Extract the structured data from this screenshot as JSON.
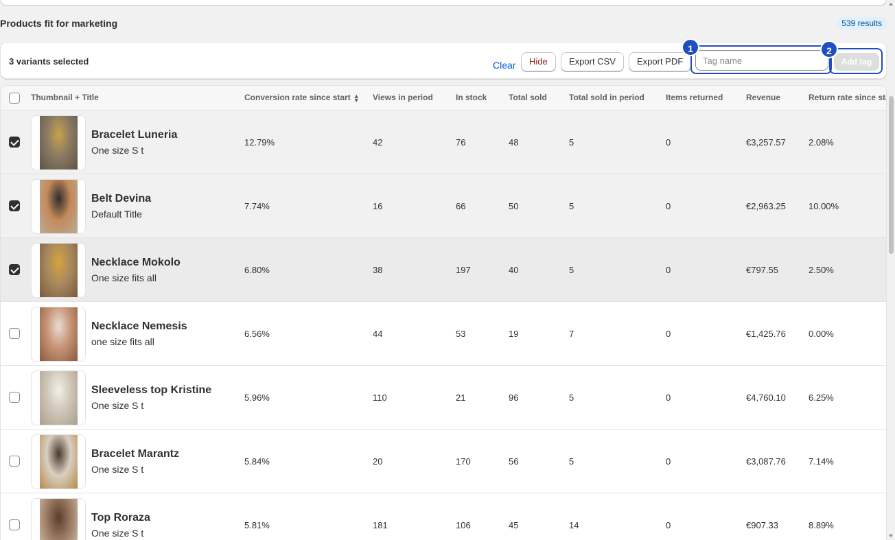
{
  "section": {
    "title": "Products fit for marketing",
    "results": "539 results"
  },
  "bulk": {
    "selected_text": "3 variants selected",
    "clear": "Clear",
    "hide": "Hide",
    "export_csv": "Export CSV",
    "export_pdf": "Export PDF",
    "tag_placeholder": "Tag name",
    "add_tag": "Add tag",
    "marker_1": "1",
    "marker_2": "2"
  },
  "columns": {
    "thumb_title": "Thumbnail + Title",
    "conversion": "Conversion rate since start",
    "views": "Views in period",
    "in_stock": "In stock",
    "total_sold": "Total sold",
    "sold_period": "Total sold in period",
    "returned": "Items returned",
    "revenue": "Revenue",
    "return_rate": "Return rate since sta"
  },
  "rows": [
    {
      "title": "Bracelet Luneria",
      "variant": "One size S t",
      "conversion": "12.79%",
      "views": "42",
      "in_stock": "76",
      "total_sold": "48",
      "sold_period": "5",
      "returned": "0",
      "revenue": "€3,257.57",
      "return_rate": "2.08%",
      "checked": true
    },
    {
      "title": "Belt Devina",
      "variant": "Default Title",
      "conversion": "7.74%",
      "views": "16",
      "in_stock": "66",
      "total_sold": "50",
      "sold_period": "5",
      "returned": "0",
      "revenue": "€2,963.25",
      "return_rate": "10.00%",
      "checked": true
    },
    {
      "title": "Necklace Mokolo",
      "variant": "One size fits all",
      "conversion": "6.80%",
      "views": "38",
      "in_stock": "197",
      "total_sold": "40",
      "sold_period": "5",
      "returned": "0",
      "revenue": "€797.55",
      "return_rate": "2.50%",
      "checked": true
    },
    {
      "title": "Necklace Nemesis",
      "variant": "one size fits all",
      "conversion": "6.56%",
      "views": "44",
      "in_stock": "53",
      "total_sold": "19",
      "sold_period": "7",
      "returned": "0",
      "revenue": "€1,425.76",
      "return_rate": "0.00%",
      "checked": false
    },
    {
      "title": "Sleeveless top Kristine",
      "variant": "One size S t",
      "conversion": "5.96%",
      "views": "110",
      "in_stock": "21",
      "total_sold": "96",
      "sold_period": "5",
      "returned": "0",
      "revenue": "€4,760.10",
      "return_rate": "6.25%",
      "checked": false
    },
    {
      "title": "Bracelet Marantz",
      "variant": "One size S t",
      "conversion": "5.84%",
      "views": "20",
      "in_stock": "170",
      "total_sold": "56",
      "sold_period": "5",
      "returned": "0",
      "revenue": "€3,087.76",
      "return_rate": "7.14%",
      "checked": false
    },
    {
      "title": "Top Roraza",
      "variant": "One size S t",
      "conversion": "5.81%",
      "views": "181",
      "in_stock": "106",
      "total_sold": "45",
      "sold_period": "14",
      "returned": "0",
      "revenue": "€907.33",
      "return_rate": "8.89%",
      "checked": false
    }
  ],
  "colors": {
    "accent": "#1f4ebf",
    "link": "#005bd3",
    "danger": "#8e1f0b"
  }
}
